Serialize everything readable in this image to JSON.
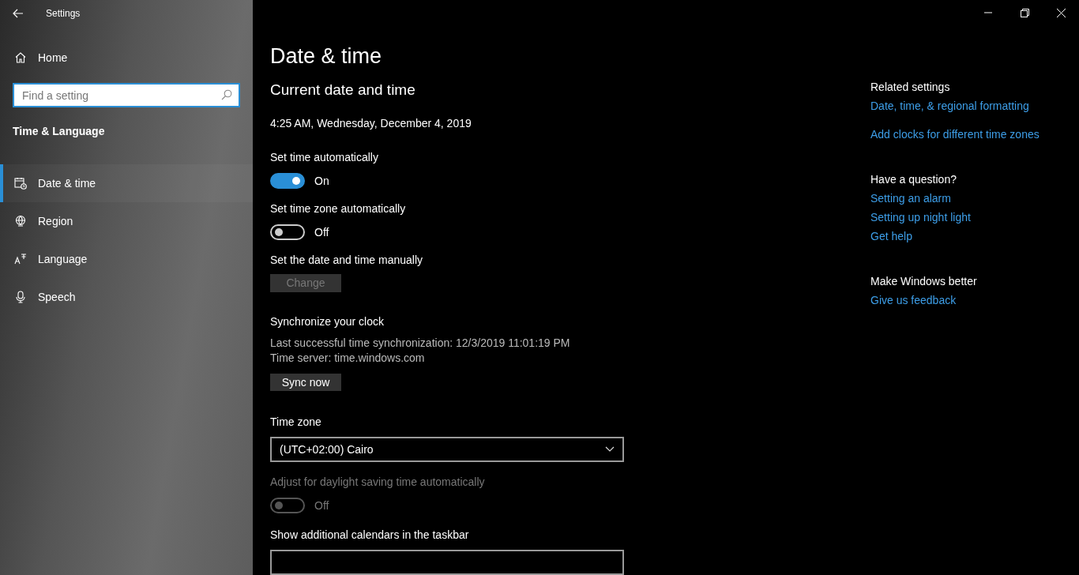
{
  "window": {
    "title": "Settings"
  },
  "sidebar": {
    "home": "Home",
    "search": {
      "placeholder": "Find a setting"
    },
    "section": "Time & Language",
    "items": [
      {
        "label": "Date & time",
        "selected": true
      },
      {
        "label": "Region",
        "selected": false
      },
      {
        "label": "Language",
        "selected": false
      },
      {
        "label": "Speech",
        "selected": false
      }
    ]
  },
  "main": {
    "title": "Date & time",
    "items": [
      {
        "kind": "heading",
        "text": "Current date and time"
      },
      {
        "kind": "text",
        "text": "4:25 AM, Wednesday, December 4, 2019"
      },
      {
        "kind": "toggle",
        "label": "Set time automatically",
        "on": true,
        "state": "On",
        "disabled": false
      },
      {
        "kind": "toggle",
        "label": "Set time zone automatically",
        "on": false,
        "state": "Off",
        "disabled": false
      },
      {
        "kind": "button",
        "label": "Set the date and time manually",
        "button": "Change",
        "disabled": true
      },
      {
        "kind": "sync",
        "label": "Synchronize your clock",
        "lines": [
          "Last successful time synchronization: 12/3/2019 11:01:19 PM",
          "Time server: time.windows.com"
        ],
        "button": "Sync now",
        "disabled": false
      },
      {
        "kind": "dropdown",
        "label": "Time zone",
        "value": "(UTC+02:00) Cairo"
      },
      {
        "kind": "toggle",
        "label": "Adjust for daylight saving time automatically",
        "on": false,
        "state": "Off",
        "disabled": true
      },
      {
        "kind": "dropdown",
        "label": "Show additional calendars in the taskbar"
      }
    ]
  },
  "related": [
    {
      "title": "Related settings",
      "links": [
        "Date, time, & regional formatting",
        "Add clocks for different time zones"
      ]
    },
    {
      "title": "Have a question?",
      "links": [
        "Setting an alarm",
        "Setting up night light",
        "Get help"
      ]
    },
    {
      "title": "Make Windows better",
      "links": [
        "Give us feedback"
      ]
    }
  ]
}
